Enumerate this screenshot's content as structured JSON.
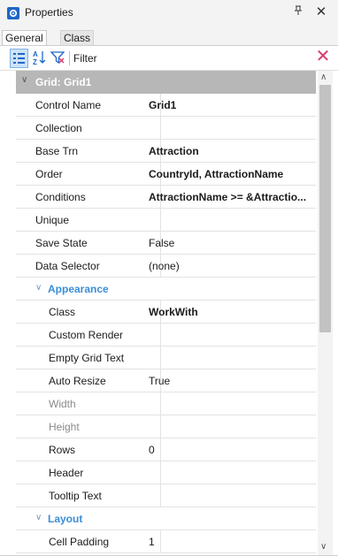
{
  "window": {
    "title": "Properties",
    "pin_glyph": "⊥",
    "close_glyph": "✕",
    "icon": "gear-icon"
  },
  "tabs": [
    {
      "label": "General",
      "active": true
    },
    {
      "label": "Class",
      "active": false
    }
  ],
  "toolbar": {
    "filter_label": "Filter",
    "filter_value": "",
    "clear_glyph": "✕"
  },
  "grid": {
    "header_label": "Grid: Grid1",
    "rows": [
      {
        "name": "Control Name",
        "value": "Grid1",
        "bold": true
      },
      {
        "name": "Collection",
        "value": ""
      },
      {
        "name": "Base Trn",
        "value": "Attraction",
        "bold": true
      },
      {
        "name": "Order",
        "value": "CountryId, AttractionName",
        "bold": true
      },
      {
        "name": "Conditions",
        "value": "AttractionName >= &Attractio...",
        "bold": true
      },
      {
        "name": "Unique",
        "value": ""
      },
      {
        "name": "Save State",
        "value": "False"
      },
      {
        "name": "Data Selector",
        "value": "(none)"
      }
    ],
    "appearance": {
      "label": "Appearance",
      "rows": [
        {
          "name": "Class",
          "value": "WorkWith",
          "bold": true
        },
        {
          "name": "Custom Render",
          "value": ""
        },
        {
          "name": "Empty Grid Text",
          "value": ""
        },
        {
          "name": "Auto Resize",
          "value": "True"
        },
        {
          "name": "Width",
          "value": "",
          "dim": true
        },
        {
          "name": "Height",
          "value": "",
          "dim": true
        },
        {
          "name": "Rows",
          "value": "0"
        },
        {
          "name": "Header",
          "value": ""
        },
        {
          "name": "Tooltip Text",
          "value": ""
        }
      ]
    },
    "layout": {
      "label": "Layout",
      "rows": [
        {
          "name": "Cell Padding",
          "value": "1"
        }
      ]
    }
  },
  "colors": {
    "accent": "#1e66c8",
    "section": "#3a8ed8",
    "header_bg": "#b7b7b7"
  }
}
